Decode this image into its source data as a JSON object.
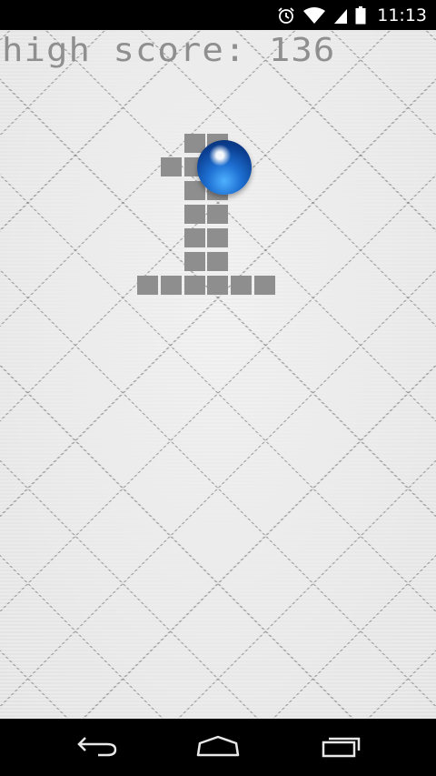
{
  "status_bar": {
    "time": "11:13",
    "icons": [
      "alarm-icon",
      "wifi-icon",
      "signal-icon",
      "battery-icon"
    ]
  },
  "game": {
    "high_score_text": "high score: 136",
    "level_number": 1,
    "ball_color": "#1d6fd1",
    "block_color": "#8e8e8e"
  },
  "nav_bar": {
    "buttons": [
      "back-icon",
      "home-icon",
      "recent-apps-icon"
    ]
  }
}
